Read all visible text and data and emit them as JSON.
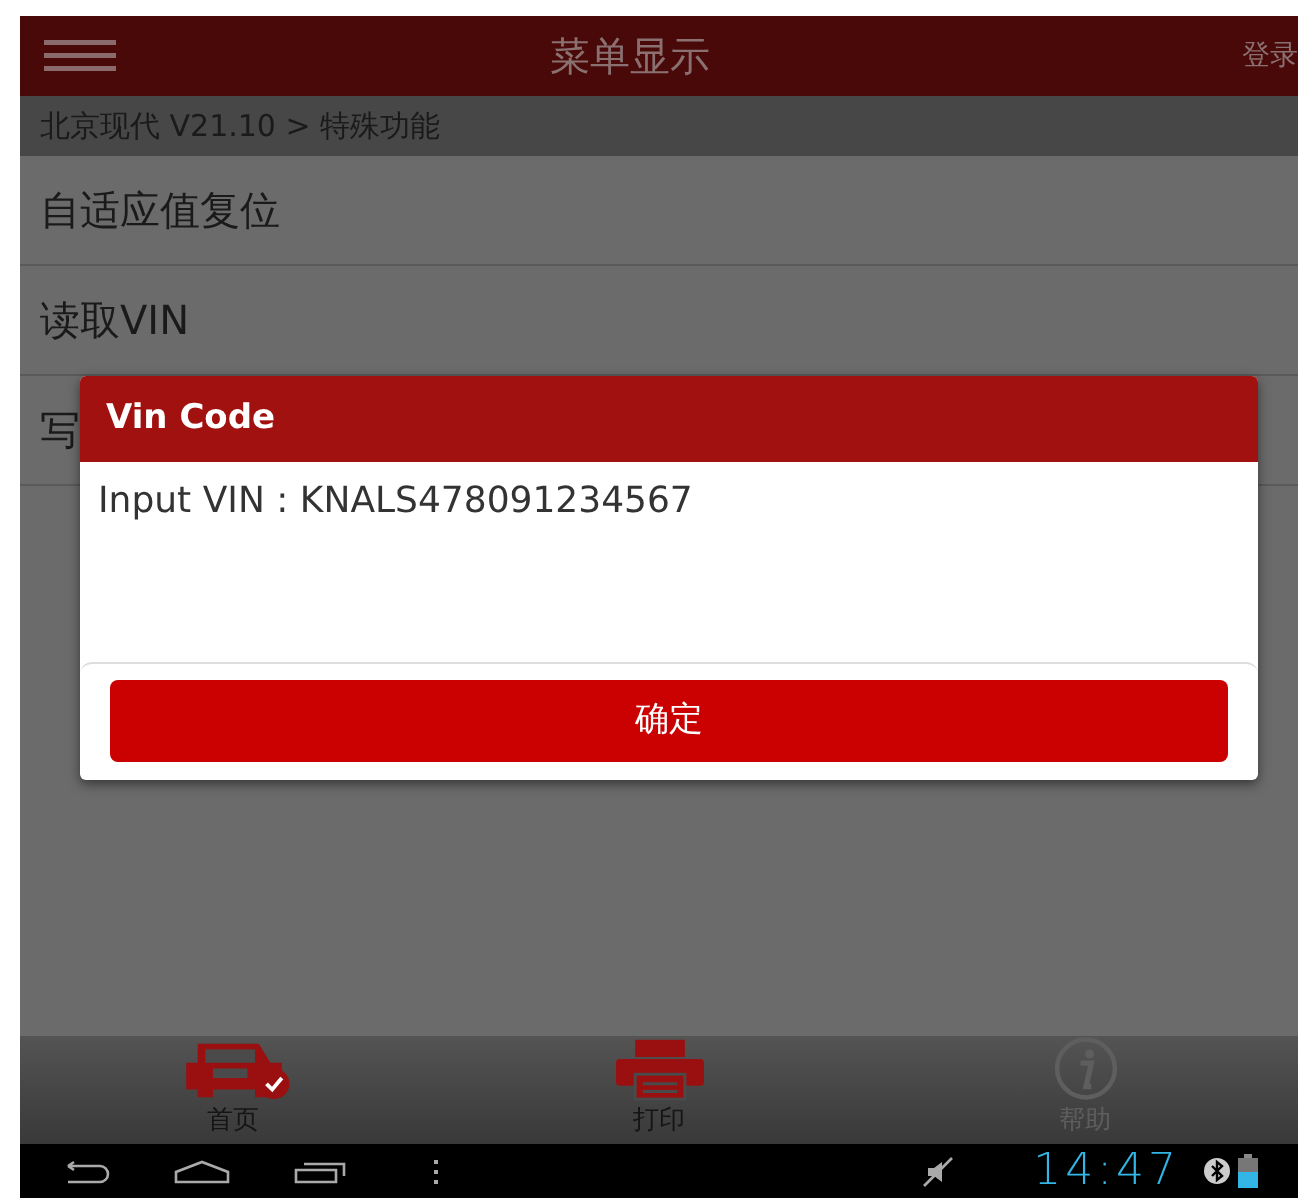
{
  "header": {
    "title": "菜单显示",
    "login": "登录"
  },
  "breadcrumb": "北京现代 V21.10 > 特殊功能",
  "menu_items": [
    "自适应值复位",
    "读取VIN",
    "写"
  ],
  "dialog": {
    "title": "Vin Code",
    "message": "Input VIN : KNALS478091234567",
    "ok_button": "确定"
  },
  "bottom_nav": [
    {
      "kind": "home",
      "label": "首页",
      "disabled": false
    },
    {
      "kind": "print",
      "label": "打印",
      "disabled": false
    },
    {
      "kind": "help",
      "label": "帮助",
      "disabled": true
    }
  ],
  "status_bar": {
    "time": "14:47"
  }
}
